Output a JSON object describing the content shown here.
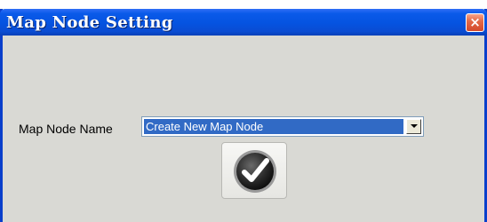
{
  "window": {
    "title": "Map Node Setting",
    "close_glyph": "×"
  },
  "form": {
    "map_node_name_label": "Map Node Name",
    "map_node_name_value": "Create New Map Node"
  },
  "icons": {
    "close": "close-icon",
    "dropdown": "chevron-down-icon",
    "confirm": "checkmark-icon"
  },
  "colors": {
    "titlebar": "#0553e0",
    "selection": "#316ac5",
    "close_button": "#d4492a"
  }
}
